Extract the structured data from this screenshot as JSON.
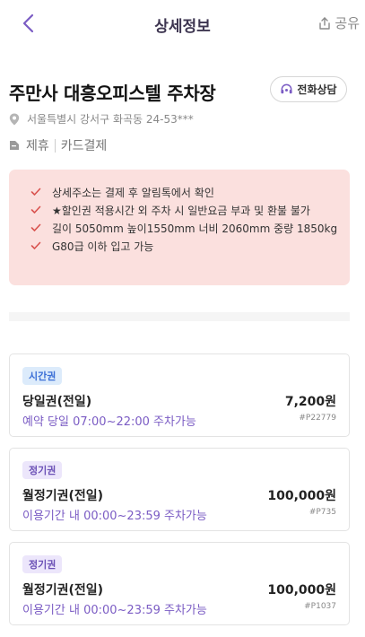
{
  "header": {
    "title": "상세정보",
    "share_label": "공유"
  },
  "lot": {
    "name": "주만사 대흥오피스텔 주차장",
    "call_label": "전화상담",
    "address": "서울특별시 강서구 화곡동 24-53***",
    "features": [
      "제휴",
      "카드결제"
    ]
  },
  "notices": [
    "상세주소는 결제 후 알림톡에서 확인",
    "★할인권 적용시간 외 주차 시 일반요금 부과 및 환불 불가",
    "길이 5050mm 높이1550mm 너비 2060mm 중량 1850kg",
    "G80급 이하 입고 가능"
  ],
  "tickets": [
    {
      "badge": "시간권",
      "name": "당일권(전일)",
      "price": "7,200원",
      "time": "예약 당일 07:00~22:00 주차가능",
      "code": "#P22779"
    },
    {
      "badge": "정기권",
      "name": "월정기권(전일)",
      "price": "100,000원",
      "time": "이용기간 내 00:00~23:59 주차가능",
      "code": "#P735"
    },
    {
      "badge": "정기권",
      "name": "월정기권(전일)",
      "price": "100,000원",
      "time": "이용기간 내 00:00~23:59 주차가능",
      "code": "#P1037"
    }
  ],
  "colors": {
    "accent": "#7b5cc4",
    "notice_bg": "#fbe0de",
    "check": "#d9534f",
    "hourly_badge": "#dcebfb",
    "monthly_badge": "#ece6fb"
  }
}
